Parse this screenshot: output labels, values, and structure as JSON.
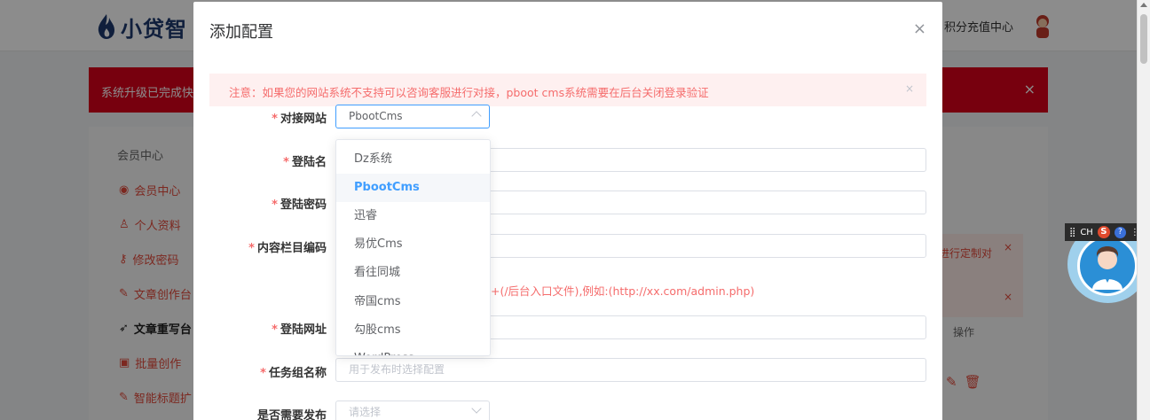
{
  "background": {
    "logo_text": "小贷智",
    "points_link": "积分充值中心",
    "banner_text": "系统升级已完成快",
    "banner_close": "×",
    "sidebar": {
      "title": "会员中心",
      "items": [
        {
          "label": "会员中心",
          "icon": "user-circle-icon"
        },
        {
          "label": "个人资料",
          "icon": "person-icon"
        },
        {
          "label": "修改密码",
          "icon": "key-icon"
        },
        {
          "label": "文章创作台",
          "icon": "pen-icon"
        },
        {
          "label": "文章重写台",
          "icon": "rocket-icon"
        },
        {
          "label": "批量创作",
          "icon": "file-icon"
        },
        {
          "label": "智能标题扩",
          "icon": "pen-icon"
        }
      ]
    },
    "right_note": "进行定制对",
    "operation_header": "操作"
  },
  "modal": {
    "title": "添加配置",
    "close_label": "×",
    "alert_text": "注意：如果您的网站系统不支持可以咨询客服进行对接，pboot cms系统需要在后台关闭登录验证",
    "alert_close": "×",
    "fields": {
      "site_label": "对接网站",
      "site_value": "PbootCms",
      "login_name_label": "登陆名",
      "login_password_label": "登陆密码",
      "column_code_label": "内容栏目编码",
      "url_hint": "+(/后台入口文件),例如:(http://xx.com/admin.php)",
      "login_url_label": "登陆网址",
      "task_group_label": "任务组名称",
      "task_group_placeholder": "用于发布时选择配置",
      "publish_label": "是否需要发布",
      "publish_placeholder": "请选择"
    },
    "dropdown_options": [
      "Dz系统",
      "PbootCms",
      "迅睿",
      "易优Cms",
      "看往同城",
      "帝国cms",
      "勾股cms",
      "WordPress"
    ],
    "selected_option": "PbootCms"
  },
  "ime_toolbar": {
    "label": "CH",
    "sogou": "S",
    "help": "?"
  }
}
